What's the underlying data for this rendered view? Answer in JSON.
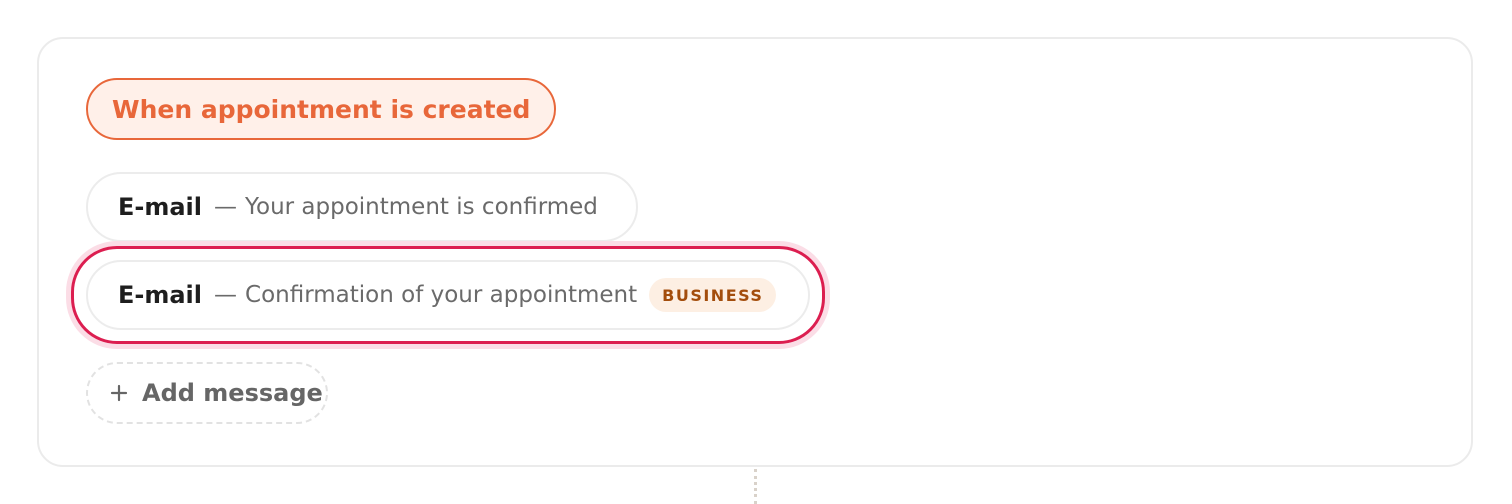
{
  "workflow": {
    "trigger_label": "When appointment is created",
    "messages": [
      {
        "type": "E-mail",
        "separator": "—",
        "description": "Your appointment is confirmed",
        "badge": ""
      },
      {
        "type": "E-mail",
        "separator": "—",
        "description": "Confirmation of your appointment",
        "badge": "BUSINESS",
        "selected": true
      }
    ],
    "add_message_label": "Add message"
  },
  "icons": {
    "add": "plus-icon"
  },
  "colors": {
    "trigger_accent": "#e8673a",
    "trigger_background": "#fff0e9",
    "selection": "#dc1e50",
    "badge_text": "#a34d0c",
    "badge_background": "#fdefe3"
  }
}
